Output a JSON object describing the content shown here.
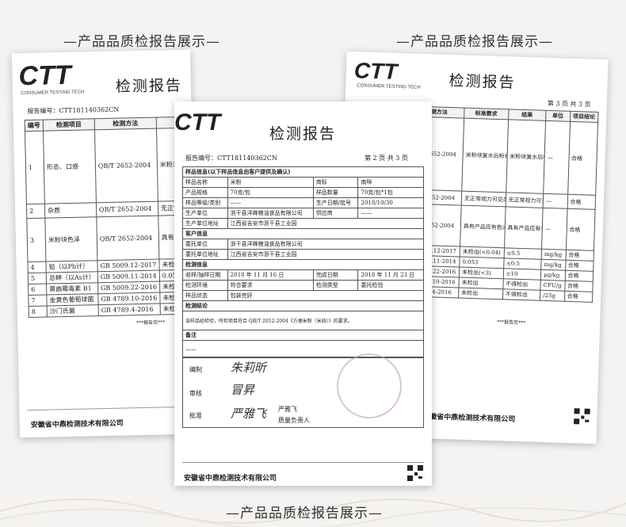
{
  "banners": {
    "top_left": "—产品品质检报告展示—",
    "top_right": "—产品品质检报告展示—",
    "bottom": "—产品品质检报告展示—"
  },
  "logo": {
    "text": "CTT",
    "sub": "CONSUMER TESTING TECH"
  },
  "left_page": {
    "title": "检测报告",
    "report_no": "报告编号：CTT181140362CN",
    "headers": [
      "编号",
      "检测项目",
      "检测方法",
      "结果"
    ],
    "rows": [
      [
        "1",
        "形态、口感",
        "QB/T 2652-2004",
        "米粉洁白无杂..."
      ],
      [
        "2",
        "杂质",
        "QB/T 2652-2004",
        "无正常视力可见杂质"
      ],
      [
        "3",
        "米粉块色泽",
        "QB/T 2652-2004",
        "具有产品应有色泽..."
      ],
      [
        "4",
        "铅（以Pb计）",
        "GB 5009.12-2017",
        "未检出(<0.04)"
      ],
      [
        "5",
        "总砷（以As计）",
        "GB 5009.11-2014",
        "0.053"
      ],
      [
        "6",
        "黄曲霉毒素 B1",
        "GB 5009.22-2016",
        "未检出(<3)"
      ],
      [
        "7",
        "金黄色葡萄球菌",
        "GB 4789.10-2016",
        "未检出"
      ],
      [
        "8",
        "沙门氏菌",
        "GB 4789.4-2016",
        "未检出"
      ]
    ],
    "end": "***报告完***",
    "footer": "安徽省中鼎检测技术有限公司"
  },
  "right_page": {
    "title": "检测报告",
    "page_no": "第 3 页  共 3 页",
    "headers": [
      "检测方法",
      "标准要求",
      "结果",
      "单位",
      "项目结论"
    ],
    "rows": [
      [
        "QB/T 2652-2004",
        "米粉块复水后粉条厚度、宽度基本均匀一致，表面平滑，口感滑爽",
        "米粉块复水后粉条厚度、宽度基本均匀一致，表面平滑，口感滑爽",
        "—",
        "合格"
      ],
      [
        "QB/T 2652-2004",
        "无正常视力可见杂质",
        "无正常视力可见杂质",
        "—",
        "合格"
      ],
      [
        "QB/T 2652-2004",
        "具有产品应有色泽，基本均匀一致的色泽",
        "具有产品应有色泽，基本均匀一致",
        "—",
        "合格"
      ],
      [
        "GB 5009.12-2017",
        "未检出(<0.04)",
        "≤0.5",
        "mg/kg",
        "合格"
      ],
      [
        "GB 5009.11-2014",
        "0.053",
        "≤0.5",
        "mg/kg",
        "合格"
      ],
      [
        "GB 5009.22-2016",
        "未检出(<3)",
        "≤10",
        "μg/kg",
        "合格"
      ],
      [
        "GB 4789.10-2016",
        "未检出",
        "不得检出",
        "CFU/g",
        "合格"
      ],
      [
        "GB 4789.4-2016",
        "未检出",
        "不得检出",
        "/25g",
        "合格"
      ]
    ],
    "end": "***报告完***",
    "footer": "安徽省中鼎检测技术有限公司"
  },
  "center_page": {
    "title": "检测报告",
    "report_no": "报告编号：CTT181140362CN",
    "page_no": "第 2 页  共 3 页",
    "section_sample": "样品信息(以下样品信息由客户提供及确认)",
    "sample_rows": [
      [
        "样品名称",
        "米粉",
        "商标",
        "南咪"
      ],
      [
        "产品规格",
        "70克/包",
        "样品数量",
        "70克/包*1包"
      ],
      [
        "样品等级/类别",
        "——",
        "生产日期/批号",
        "2018/10/30"
      ],
      [
        "生产单位",
        "浙干县洋峰粮油食品有限公司",
        "供应商",
        "——"
      ],
      [
        "生产单位地址",
        "江西省吉安市浙干县工业园",
        "",
        ""
      ]
    ],
    "section_client": "客户信息",
    "client_rows": [
      [
        "委托单位",
        "浙干县洋峰粮油食品有限公司"
      ],
      [
        "委托单位地址",
        "江西省吉安市浙干县工业园"
      ]
    ],
    "section_test": "检测信息",
    "test_rows": [
      [
        "收样/抽样日期",
        "2018 年 11 月 16 日",
        "完成日期",
        "2018 年 11 月 23 日"
      ],
      [
        "检测环境",
        "符合要求",
        "检测类型",
        "委托检验"
      ],
      [
        "样品状态",
        "包装完好",
        "",
        ""
      ]
    ],
    "section_conclusion": "检测结论",
    "conclusion": "该样品经检验，所检项目符合 QB/T 2652-2004《方便米粉（米线）》的要求。",
    "section_remarks": "备注",
    "remarks": "——",
    "sign_labels": [
      "编制",
      "审核",
      "批准"
    ],
    "signatures": [
      "朱莉昕",
      "冒昇",
      "严雅飞"
    ],
    "approver": "严雅飞",
    "approver_title": "质量负责人",
    "footer": "安徽省中鼎检测技术有限公司"
  }
}
